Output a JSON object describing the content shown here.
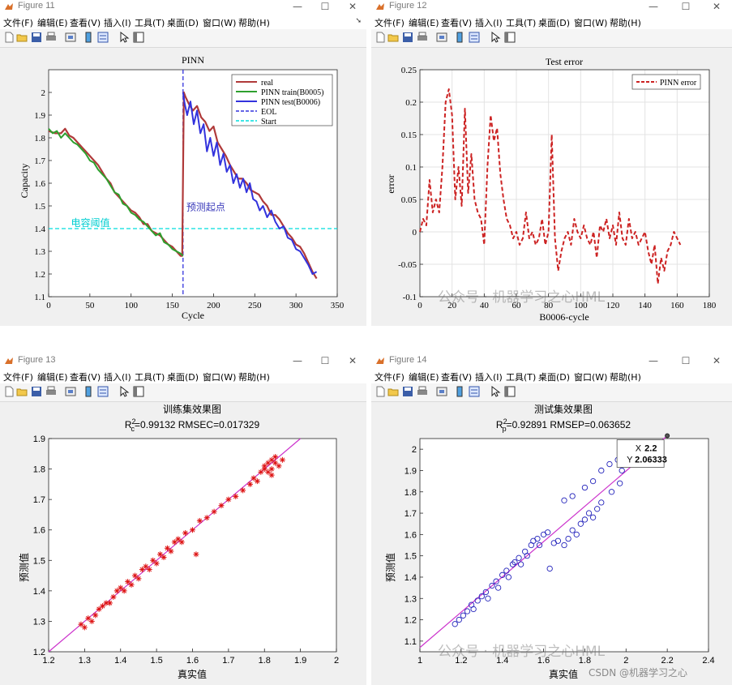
{
  "menu": [
    "文件(F)",
    "编辑(E)",
    "查看(V)",
    "插入(I)",
    "工具(T)",
    "桌面(D)",
    "窗口(W)",
    "帮助(H)"
  ],
  "controls": {
    "minimize": "—",
    "maximize": "☐",
    "close": "✕"
  },
  "windows": [
    {
      "title": "Figure 11"
    },
    {
      "title": "Figure 12"
    },
    {
      "title": "Figure 13"
    },
    {
      "title": "Figure 14"
    }
  ],
  "watermarks": {
    "wechat": "公众号 · 机器学习之心HML",
    "csdn": "CSDN @机器学习之心"
  },
  "chart_data": [
    {
      "type": "line",
      "title": "PINN",
      "xlabel": "Cycle",
      "ylabel": "Capacity",
      "xlim": [
        0,
        350
      ],
      "ylim": [
        1.1,
        2.1
      ],
      "xticks": [
        0,
        50,
        100,
        150,
        200,
        250,
        300,
        350
      ],
      "yticks": [
        1.1,
        1.2,
        1.3,
        1.4,
        1.5,
        1.6,
        1.7,
        1.8,
        1.9,
        2
      ],
      "legend_position": "top-right",
      "annotations": [
        {
          "text": "电容阈值",
          "x": 27,
          "y": 1.41,
          "color": "#00ced1"
        },
        {
          "text": "预测起点",
          "x": 167,
          "y": 1.48,
          "color": "#3b3bbb"
        }
      ],
      "series": [
        {
          "name": "real",
          "color": "#b03a3a",
          "style": "solid",
          "x": [
            0,
            8,
            15,
            20,
            25,
            30,
            35,
            40,
            45,
            50,
            55,
            60,
            65,
            70,
            75,
            80,
            85,
            90,
            95,
            100,
            105,
            110,
            115,
            120,
            125,
            130,
            135,
            140,
            145,
            150,
            155,
            160,
            162,
            164,
            166,
            170,
            175,
            180,
            185,
            190,
            195,
            200,
            205,
            210,
            215,
            220,
            225,
            230,
            235,
            240,
            245,
            250,
            255,
            260,
            265,
            270,
            275,
            280,
            285,
            290,
            295,
            300,
            305,
            310,
            315,
            320,
            325
          ],
          "y": [
            1.83,
            1.82,
            1.82,
            1.84,
            1.81,
            1.8,
            1.78,
            1.76,
            1.74,
            1.72,
            1.7,
            1.68,
            1.65,
            1.62,
            1.6,
            1.56,
            1.54,
            1.52,
            1.5,
            1.48,
            1.47,
            1.45,
            1.42,
            1.42,
            1.39,
            1.38,
            1.37,
            1.35,
            1.33,
            1.32,
            1.3,
            1.28,
            1.28,
            2.0,
            1.98,
            1.95,
            1.92,
            1.94,
            1.89,
            1.87,
            1.83,
            1.85,
            1.78,
            1.75,
            1.72,
            1.68,
            1.65,
            1.62,
            1.62,
            1.6,
            1.57,
            1.56,
            1.55,
            1.52,
            1.5,
            1.46,
            1.46,
            1.44,
            1.41,
            1.38,
            1.36,
            1.33,
            1.32,
            1.29,
            1.25,
            1.21,
            1.18
          ]
        },
        {
          "name": "PINN train(B0005)",
          "color": "#2ea02e",
          "style": "solid",
          "x": [
            0,
            5,
            10,
            15,
            20,
            25,
            30,
            35,
            40,
            45,
            50,
            55,
            60,
            65,
            70,
            75,
            80,
            85,
            90,
            95,
            100,
            105,
            110,
            115,
            120,
            125,
            130,
            135,
            140,
            145,
            150,
            155,
            160,
            163
          ],
          "y": [
            1.84,
            1.82,
            1.83,
            1.8,
            1.82,
            1.8,
            1.78,
            1.77,
            1.75,
            1.73,
            1.7,
            1.69,
            1.66,
            1.64,
            1.62,
            1.59,
            1.56,
            1.55,
            1.51,
            1.5,
            1.47,
            1.46,
            1.44,
            1.43,
            1.41,
            1.39,
            1.37,
            1.38,
            1.34,
            1.33,
            1.31,
            1.3,
            1.29,
            1.28
          ]
        },
        {
          "name": "PINN test(B0006)",
          "color": "#3333dd",
          "style": "solid",
          "x": [
            163,
            165,
            168,
            172,
            176,
            180,
            184,
            188,
            192,
            196,
            200,
            204,
            208,
            212,
            216,
            220,
            224,
            228,
            232,
            236,
            240,
            244,
            248,
            252,
            256,
            260,
            265,
            270,
            275,
            280,
            285,
            290,
            295,
            300,
            305,
            310,
            315,
            320,
            325
          ],
          "y": [
            2.0,
            1.95,
            1.9,
            1.96,
            1.86,
            1.92,
            1.82,
            1.86,
            1.74,
            1.8,
            1.72,
            1.78,
            1.68,
            1.73,
            1.65,
            1.68,
            1.6,
            1.64,
            1.58,
            1.62,
            1.56,
            1.6,
            1.53,
            1.52,
            1.48,
            1.5,
            1.45,
            1.48,
            1.43,
            1.4,
            1.41,
            1.36,
            1.35,
            1.31,
            1.3,
            1.27,
            1.24,
            1.2,
            1.21
          ]
        },
        {
          "name": "EOL",
          "color": "#3333dd",
          "style": "dashed",
          "vertical_x": 163
        },
        {
          "name": "Start",
          "color": "#00dddd",
          "style": "dashed",
          "horizontal_y": 1.4
        }
      ]
    },
    {
      "type": "line",
      "title": "Test error",
      "xlabel": "B0006-cycle",
      "ylabel": "error",
      "xlim": [
        0,
        180
      ],
      "ylim": [
        -0.1,
        0.25
      ],
      "xticks": [
        0,
        20,
        40,
        60,
        80,
        100,
        120,
        140,
        160,
        180
      ],
      "yticks": [
        -0.1,
        -0.05,
        0,
        0.05,
        0.1,
        0.15,
        0.2,
        0.25
      ],
      "legend_position": "top-right",
      "series": [
        {
          "name": "PINN error",
          "color": "#cc2222",
          "style": "dashed",
          "x": [
            0,
            2,
            4,
            6,
            8,
            10,
            12,
            14,
            16,
            18,
            20,
            22,
            24,
            26,
            28,
            30,
            32,
            34,
            36,
            38,
            40,
            42,
            44,
            46,
            48,
            50,
            52,
            54,
            56,
            58,
            60,
            62,
            64,
            66,
            68,
            70,
            72,
            74,
            76,
            78,
            80,
            82,
            84,
            86,
            88,
            90,
            92,
            94,
            96,
            98,
            100,
            102,
            104,
            106,
            108,
            110,
            112,
            114,
            116,
            118,
            120,
            122,
            124,
            126,
            128,
            130,
            132,
            134,
            136,
            138,
            140,
            142,
            144,
            146,
            148,
            150,
            152,
            154,
            156,
            158,
            160,
            162
          ],
          "y": [
            0.0,
            0.02,
            0.01,
            0.08,
            0.03,
            0.05,
            0.03,
            0.1,
            0.2,
            0.22,
            0.18,
            0.05,
            0.1,
            0.04,
            0.19,
            0.06,
            0.12,
            0.05,
            0.03,
            0.02,
            -0.02,
            0.1,
            0.18,
            0.14,
            0.16,
            0.09,
            0.05,
            0.02,
            0.01,
            -0.01,
            0.0,
            -0.02,
            -0.01,
            0.03,
            -0.01,
            0.0,
            -0.02,
            -0.01,
            0.02,
            -0.02,
            0.0,
            0.15,
            -0.01,
            -0.06,
            -0.03,
            -0.01,
            0.0,
            -0.02,
            0.02,
            0.0,
            -0.01,
            0.01,
            -0.01,
            -0.02,
            0.0,
            -0.04,
            0.01,
            0.0,
            0.02,
            -0.01,
            0.01,
            -0.02,
            0.03,
            -0.01,
            -0.02,
            0.02,
            -0.01,
            0.0,
            -0.02,
            -0.01,
            0.0,
            -0.03,
            -0.05,
            -0.02,
            -0.08,
            -0.04,
            -0.06,
            -0.03,
            -0.02,
            0.0,
            -0.01,
            -0.02
          ]
        }
      ]
    },
    {
      "type": "scatter",
      "title": "训练集效果图",
      "subtitle": "R_c^2=0.99132  RMSEC=0.017329",
      "xlabel": "真实值",
      "ylabel": "预测值",
      "xlim": [
        1.2,
        2
      ],
      "ylim": [
        1.2,
        1.9
      ],
      "xticks": [
        1.2,
        1.3,
        1.4,
        1.5,
        1.6,
        1.7,
        1.8,
        1.9,
        2
      ],
      "yticks": [
        1.2,
        1.3,
        1.4,
        1.5,
        1.6,
        1.7,
        1.8,
        1.9
      ],
      "marker": "*",
      "marker_color": "#dd1111",
      "reference_line": {
        "color": "#cc33cc",
        "x": [
          1.2,
          1.9
        ],
        "y": [
          1.2,
          1.9
        ]
      },
      "points": [
        [
          1.29,
          1.29
        ],
        [
          1.3,
          1.28
        ],
        [
          1.31,
          1.31
        ],
        [
          1.32,
          1.3
        ],
        [
          1.33,
          1.32
        ],
        [
          1.34,
          1.34
        ],
        [
          1.35,
          1.35
        ],
        [
          1.36,
          1.36
        ],
        [
          1.37,
          1.36
        ],
        [
          1.38,
          1.38
        ],
        [
          1.39,
          1.4
        ],
        [
          1.4,
          1.41
        ],
        [
          1.41,
          1.4
        ],
        [
          1.42,
          1.43
        ],
        [
          1.43,
          1.42
        ],
        [
          1.44,
          1.45
        ],
        [
          1.45,
          1.44
        ],
        [
          1.46,
          1.47
        ],
        [
          1.47,
          1.48
        ],
        [
          1.48,
          1.47
        ],
        [
          1.49,
          1.5
        ],
        [
          1.5,
          1.49
        ],
        [
          1.51,
          1.52
        ],
        [
          1.52,
          1.51
        ],
        [
          1.53,
          1.54
        ],
        [
          1.54,
          1.53
        ],
        [
          1.55,
          1.56
        ],
        [
          1.56,
          1.57
        ],
        [
          1.57,
          1.56
        ],
        [
          1.58,
          1.59
        ],
        [
          1.6,
          1.6
        ],
        [
          1.61,
          1.52
        ],
        [
          1.62,
          1.63
        ],
        [
          1.64,
          1.64
        ],
        [
          1.66,
          1.66
        ],
        [
          1.68,
          1.68
        ],
        [
          1.7,
          1.7
        ],
        [
          1.72,
          1.71
        ],
        [
          1.74,
          1.73
        ],
        [
          1.76,
          1.75
        ],
        [
          1.77,
          1.77
        ],
        [
          1.78,
          1.76
        ],
        [
          1.79,
          1.79
        ],
        [
          1.8,
          1.8
        ],
        [
          1.81,
          1.82
        ],
        [
          1.82,
          1.83
        ],
        [
          1.82,
          1.8
        ],
        [
          1.83,
          1.82
        ],
        [
          1.83,
          1.84
        ],
        [
          1.84,
          1.81
        ],
        [
          1.81,
          1.79
        ],
        [
          1.8,
          1.81
        ],
        [
          1.82,
          1.78
        ],
        [
          1.85,
          1.83
        ]
      ]
    },
    {
      "type": "scatter",
      "title": "测试集效果图",
      "subtitle": "R_p^2=0.92891  RMSEP=0.063652",
      "xlabel": "真实值",
      "ylabel": "预测值",
      "xlim": [
        1,
        2.4
      ],
      "ylim": [
        1.05,
        2.05
      ],
      "xticks": [
        1,
        1.2,
        1.4,
        1.6,
        1.8,
        2,
        2.2,
        2.4
      ],
      "yticks": [
        1.1,
        1.2,
        1.3,
        1.4,
        1.5,
        1.6,
        1.7,
        1.8,
        1.9,
        2
      ],
      "marker": "o",
      "marker_color": "#2222bb",
      "reference_line": {
        "color": "#cc33cc",
        "x": [
          1.0,
          2.2
        ],
        "y": [
          1.07,
          2.06333
        ]
      },
      "datatip": {
        "x": 2.2,
        "y": 2.06333,
        "x_label": "X",
        "y_label": "Y",
        "x_text": "2.2",
        "y_text": "2.06333"
      },
      "points": [
        [
          1.17,
          1.18
        ],
        [
          1.19,
          1.2
        ],
        [
          1.21,
          1.22
        ],
        [
          1.23,
          1.24
        ],
        [
          1.25,
          1.27
        ],
        [
          1.26,
          1.25
        ],
        [
          1.28,
          1.29
        ],
        [
          1.3,
          1.31
        ],
        [
          1.32,
          1.33
        ],
        [
          1.33,
          1.3
        ],
        [
          1.35,
          1.36
        ],
        [
          1.37,
          1.38
        ],
        [
          1.38,
          1.35
        ],
        [
          1.4,
          1.41
        ],
        [
          1.42,
          1.43
        ],
        [
          1.43,
          1.4
        ],
        [
          1.45,
          1.46
        ],
        [
          1.46,
          1.47
        ],
        [
          1.48,
          1.49
        ],
        [
          1.49,
          1.46
        ],
        [
          1.51,
          1.52
        ],
        [
          1.52,
          1.5
        ],
        [
          1.54,
          1.55
        ],
        [
          1.55,
          1.57
        ],
        [
          1.57,
          1.58
        ],
        [
          1.58,
          1.55
        ],
        [
          1.6,
          1.6
        ],
        [
          1.62,
          1.61
        ],
        [
          1.63,
          1.44
        ],
        [
          1.65,
          1.56
        ],
        [
          1.67,
          1.57
        ],
        [
          1.7,
          1.55
        ],
        [
          1.72,
          1.58
        ],
        [
          1.74,
          1.62
        ],
        [
          1.76,
          1.6
        ],
        [
          1.78,
          1.65
        ],
        [
          1.8,
          1.67
        ],
        [
          1.82,
          1.7
        ],
        [
          1.84,
          1.68
        ],
        [
          1.86,
          1.72
        ],
        [
          1.88,
          1.75
        ],
        [
          1.7,
          1.76
        ],
        [
          1.74,
          1.78
        ],
        [
          1.8,
          1.82
        ],
        [
          1.84,
          1.85
        ],
        [
          1.88,
          1.9
        ],
        [
          1.92,
          1.93
        ],
        [
          1.96,
          1.95
        ],
        [
          1.98,
          1.9
        ],
        [
          1.97,
          1.84
        ],
        [
          1.93,
          1.8
        ]
      ]
    }
  ]
}
